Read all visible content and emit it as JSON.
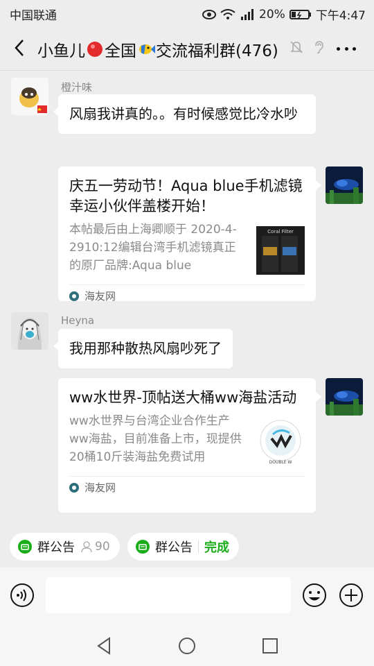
{
  "status_bar": {
    "carrier": "中国联通",
    "battery": "20%",
    "time": "下午4:47"
  },
  "header": {
    "title_part1": "小鱼儿",
    "title_part2": "全国",
    "title_part3": "交流福利群(476)"
  },
  "messages": [
    {
      "sender": "橙汁味",
      "text": "风扇我讲真的。。有时候感觉比冷水吵"
    },
    {
      "card": {
        "title": "庆五一劳动节！Aqua blue手机滤镜幸运小伙伴盖楼开始！",
        "description": "本帖最后由上海卿顺于 2020-4-2910:12编辑台湾手机滤镜真正的原厂品牌:Aqua blue",
        "thumb_label": "Coral Filter",
        "source": "海友网"
      }
    },
    {
      "sender": "Heyna",
      "text": "我用那种散热风扇吵死了"
    },
    {
      "card": {
        "title": "ww水世界-顶帖送大桶ww海盐活动",
        "description": "ww水世界与台湾企业合作生产ww海盐，目前准备上市，现提供20桶10斤装海盐免费试用",
        "thumb_label": "DOUBLE W",
        "source": "海友网"
      }
    }
  ],
  "chips": [
    {
      "label": "群公告",
      "count": "90"
    },
    {
      "label": "群公告",
      "action": "完成"
    }
  ],
  "colors": {
    "accent_green": "#1aad19",
    "background": "#ededed"
  }
}
